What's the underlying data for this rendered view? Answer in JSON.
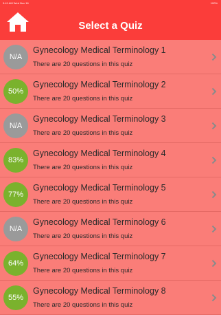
{
  "status_bar": {
    "time": "9:41 AM  Wed Nov 16",
    "battery": "100%"
  },
  "header": {
    "title": "Select a Quiz",
    "home_icon": "home-icon"
  },
  "colors": {
    "header": "#fb3d3a",
    "background": "#fa7d78",
    "na_badge": "#9a9a9a",
    "score_badge": "#7ab22d"
  },
  "quizzes": [
    {
      "title": "Gynecology Medical Terminology 1",
      "subtitle": "There are 20 questions in this quiz",
      "score": "N/A"
    },
    {
      "title": "Gynecology Medical Terminology 2",
      "subtitle": "There are 20 questions in this quiz",
      "score": "50%"
    },
    {
      "title": "Gynecology Medical Terminology 3",
      "subtitle": "There are 20 questions in this quiz",
      "score": "N/A"
    },
    {
      "title": "Gynecology Medical Terminology 4",
      "subtitle": "There are 20 questions in this quiz",
      "score": "83%"
    },
    {
      "title": "Gynecology Medical Terminology 5",
      "subtitle": "There are 20 questions in this quiz",
      "score": "77%"
    },
    {
      "title": "Gynecology Medical Terminology 6",
      "subtitle": "There are 20 questions in this quiz",
      "score": "N/A"
    },
    {
      "title": "Gynecology Medical Terminology 7",
      "subtitle": "There are 20 questions in this quiz",
      "score": "64%"
    },
    {
      "title": "Gynecology Medical Terminology 8",
      "subtitle": "There are 20 questions in this quiz",
      "score": "55%"
    }
  ]
}
